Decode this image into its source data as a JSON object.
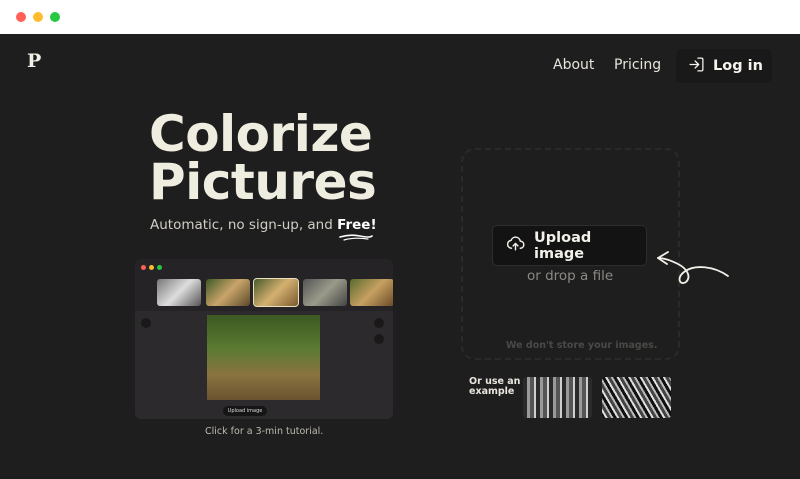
{
  "brand": {
    "logo": "P"
  },
  "nav": {
    "about": "About",
    "pricing": "Pricing",
    "login": "Log in"
  },
  "hero": {
    "title_line1": "Colorize",
    "title_line2": "Pictures",
    "subtitle_prefix": "Automatic, no sign-up, and ",
    "subtitle_free": "Free!"
  },
  "demo": {
    "upload_label": "Upload image",
    "caption": "Click for a 3-min tutorial."
  },
  "dropzone": {
    "upload_label": "Upload image",
    "drop_text": "or drop a file",
    "privacy": "We don't store your images."
  },
  "examples": {
    "label_line1": "Or use an",
    "label_line2": "example"
  },
  "colors": {
    "background": "#1f1e1e",
    "accent_text": "#efece0"
  }
}
